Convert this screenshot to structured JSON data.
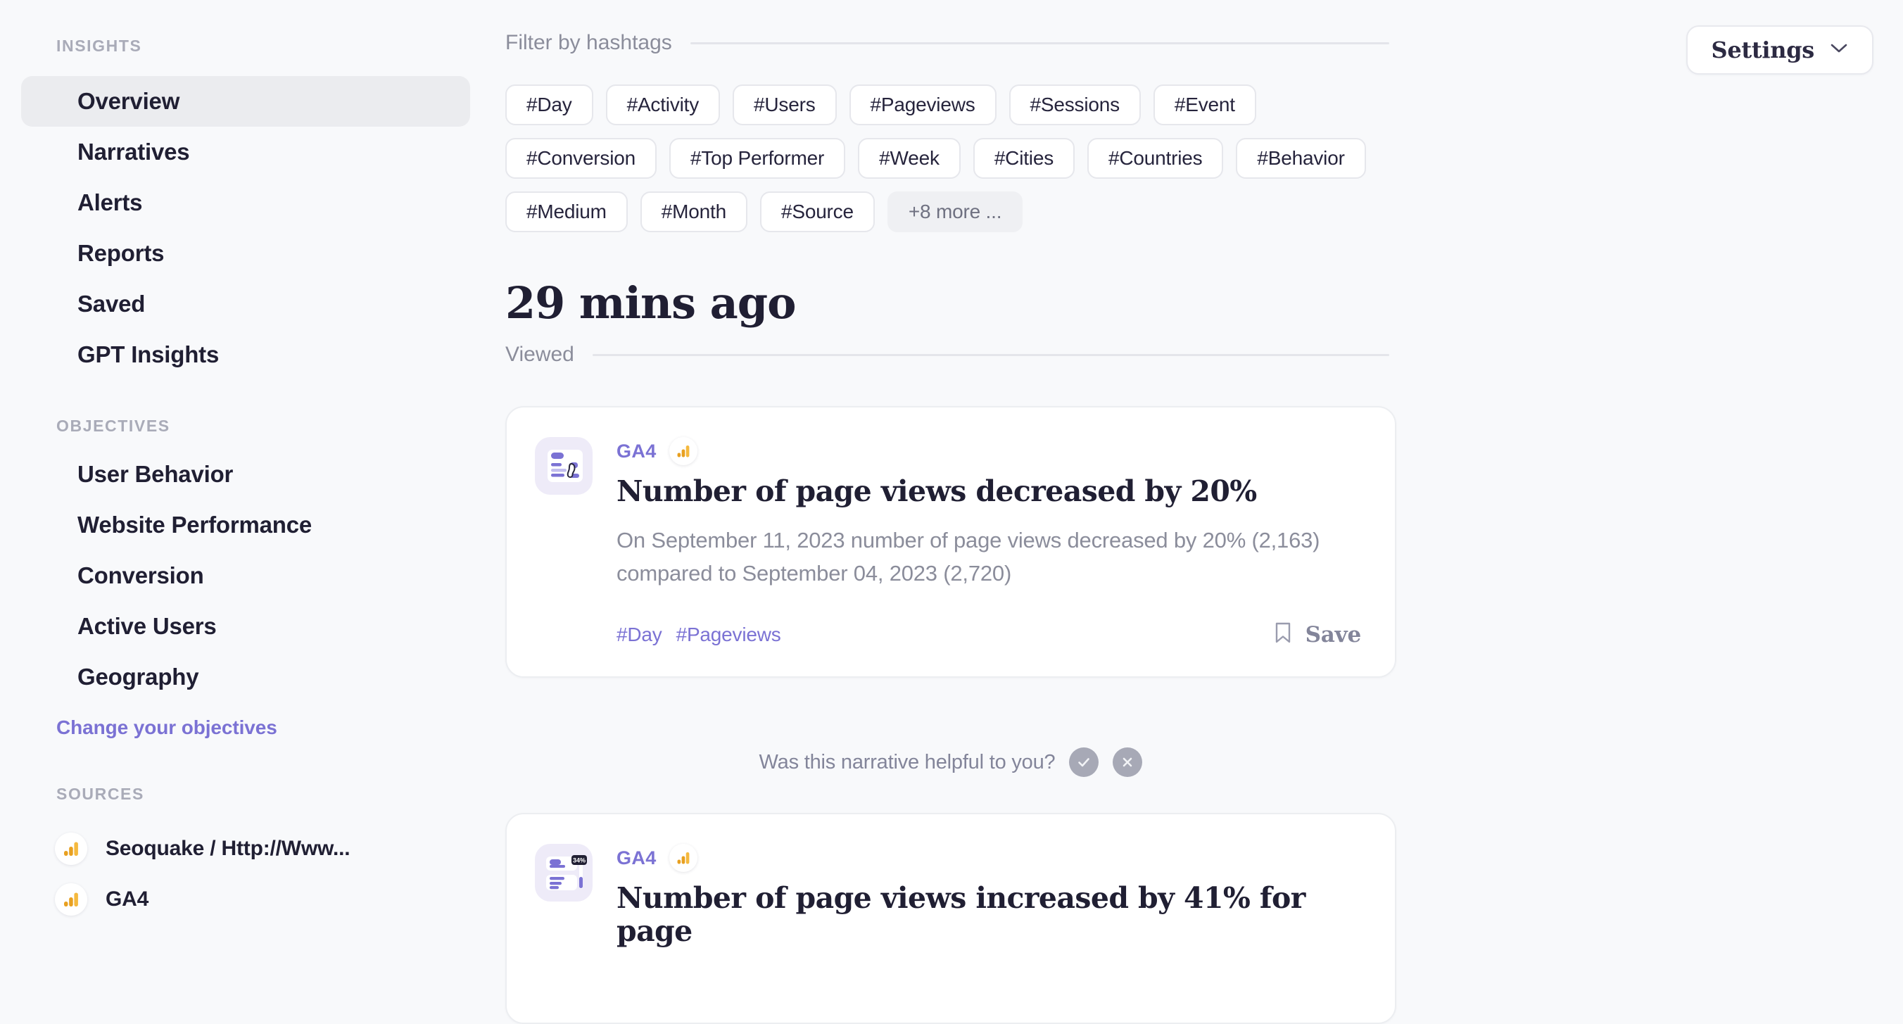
{
  "sidebar": {
    "sections": [
      {
        "label": "INSIGHTS",
        "items": [
          {
            "label": "Overview",
            "active": true
          },
          {
            "label": "Narratives",
            "active": false
          },
          {
            "label": "Alerts",
            "active": false
          },
          {
            "label": "Reports",
            "active": false
          },
          {
            "label": "Saved",
            "active": false
          },
          {
            "label": "GPT Insights",
            "active": false
          }
        ]
      },
      {
        "label": "OBJECTIVES",
        "items": [
          {
            "label": "User Behavior",
            "active": false
          },
          {
            "label": "Website Performance",
            "active": false
          },
          {
            "label": "Conversion",
            "active": false
          },
          {
            "label": "Active Users",
            "active": false
          },
          {
            "label": "Geography",
            "active": false
          }
        ],
        "link": "Change your objectives"
      },
      {
        "label": "SOURCES",
        "sources": [
          {
            "label": "Seoquake / Http://Www...",
            "icon": "ga-bars-icon"
          },
          {
            "label": "GA4",
            "icon": "ga-bars-icon"
          }
        ]
      }
    ]
  },
  "header": {
    "settings_label": "Settings",
    "chevron_icon": "chevron-down-icon"
  },
  "filter": {
    "title": "Filter by hashtags",
    "chips": [
      "#Day",
      "#Activity",
      "#Users",
      "#Pageviews",
      "#Sessions",
      "#Event",
      "#Conversion",
      "#Top Performer",
      "#Week",
      "#Cities",
      "#Countries",
      "#Behavior",
      "#Medium",
      "#Month",
      "#Source"
    ],
    "more_label": "+8 more ..."
  },
  "feed": {
    "time_heading": "29 mins ago",
    "status_label": "Viewed",
    "cards": [
      {
        "source": "GA4",
        "source_icon": "ga-bars-icon",
        "icon": "narrative-cursor-icon",
        "title": "Number of page views decreased by 20%",
        "text": "On September 11, 2023 number of page views decreased by 20% (2,163) compared to September 04, 2023 (2,720)",
        "tags": [
          "#Day",
          "#Pageviews"
        ],
        "save_label": "Save",
        "save_icon": "bookmark-icon"
      },
      {
        "source": "GA4",
        "source_icon": "ga-bars-icon",
        "icon": "narrative-badge-icon",
        "title": "Number of page views increased by 41% for page",
        "badge_value": "34%"
      }
    ],
    "feedback": {
      "question": "Was this narrative helpful to you?",
      "yes_icon": "check-circle-icon",
      "no_icon": "x-circle-icon"
    }
  },
  "colors": {
    "accent": "#7b72d4",
    "background": "#f8f9fb",
    "text": "#201f33",
    "muted": "#8b8d9b",
    "ga_orange": "#e8a020",
    "ga_amber": "#f5b93e"
  }
}
